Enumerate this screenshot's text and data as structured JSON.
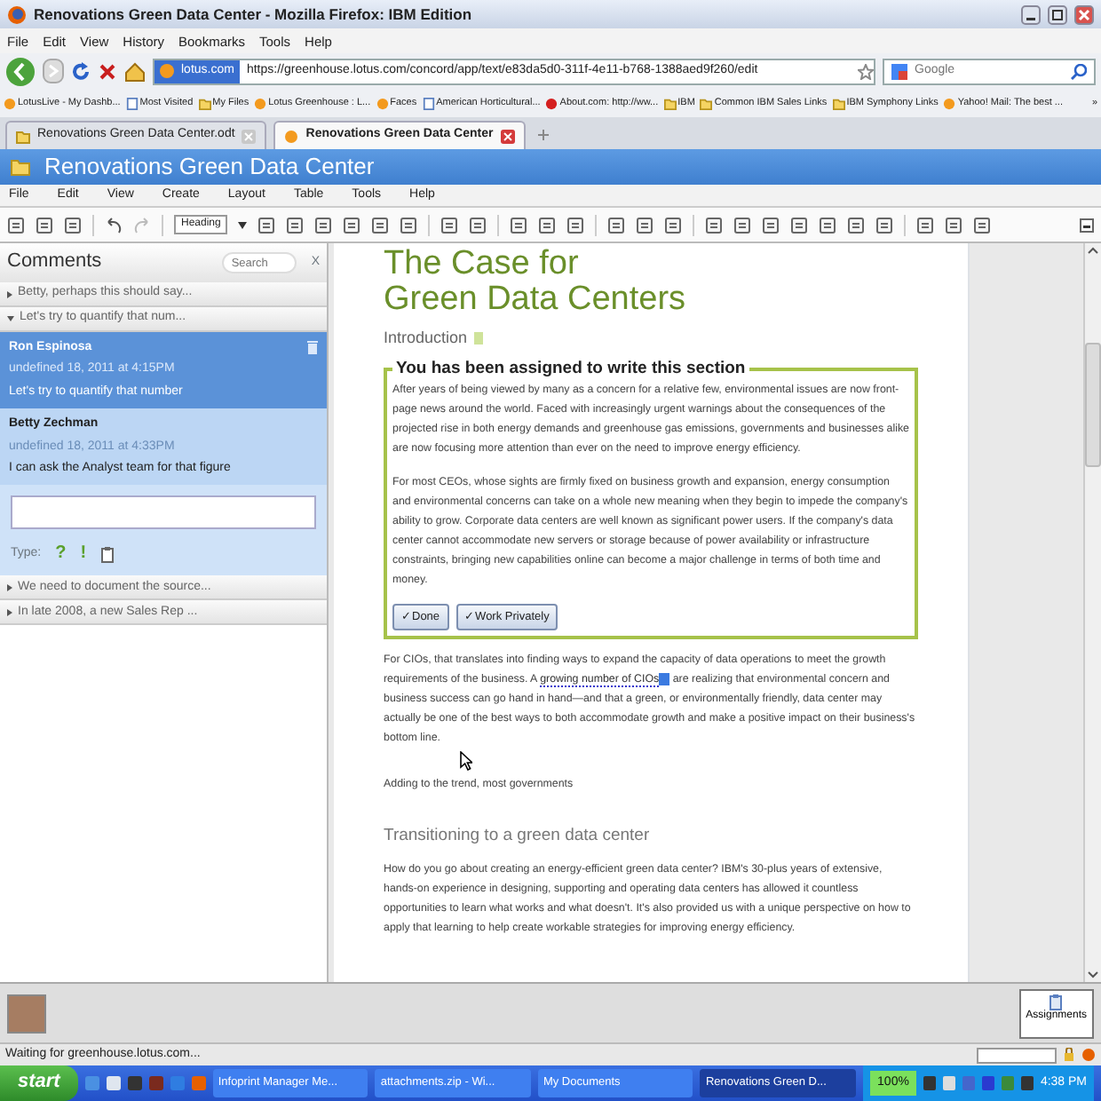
{
  "window": {
    "title": "Renovations Green Data Center - Mozilla Firefox: IBM Edition"
  },
  "menu_bar": [
    "File",
    "Edit",
    "View",
    "History",
    "Bookmarks",
    "Tools",
    "Help"
  ],
  "address_bar": {
    "site_label": "lotus.com",
    "url": "https://greenhouse.lotus.com/concord/app/text/e83da5d0-311f-4e11-b768-1388aed9f260/edit"
  },
  "search_field": {
    "placeholder": "Google"
  },
  "bookmarks": [
    {
      "label": "LotusLive - My Dashb...",
      "kind": "site"
    },
    {
      "label": "Most Visited",
      "kind": "page"
    },
    {
      "label": "My Files",
      "kind": "folder"
    },
    {
      "label": "Lotus Greenhouse : L...",
      "kind": "site"
    },
    {
      "label": "Faces",
      "kind": "site"
    },
    {
      "label": "American Horticultural...",
      "kind": "page"
    },
    {
      "label": "About.com: http://ww...",
      "kind": "ball"
    },
    {
      "label": "IBM",
      "kind": "folder"
    },
    {
      "label": "Common IBM Sales Links",
      "kind": "folder"
    },
    {
      "label": "IBM Symphony Links",
      "kind": "folder"
    },
    {
      "label": "Yahoo! Mail: The best ...",
      "kind": "site"
    }
  ],
  "bookmarks_more": "»",
  "tabs": [
    {
      "label": "Renovations Green Data Center.odt",
      "selected": false
    },
    {
      "label": "Renovations Green Data Center",
      "selected": true
    }
  ],
  "app": {
    "title": "Renovations Green Data Center",
    "menu": [
      "File",
      "Edit",
      "View",
      "Create",
      "Layout",
      "Table",
      "Tools",
      "Help"
    ],
    "style_select": "Heading"
  },
  "comments": {
    "title": "Comments",
    "search_placeholder": "Search",
    "close": "X",
    "threads": [
      {
        "summary": "Betty, perhaps this should say...",
        "expanded": false
      },
      {
        "summary": "Let's try to quantify that num...",
        "expanded": true,
        "replies": [
          {
            "author": "Ron Espinosa",
            "time": "undefined 18, 2011 at 4:15PM",
            "text": "Let's try to quantify that number",
            "selected": true
          },
          {
            "author": "Betty Zechman",
            "time": "undefined 18, 2011 at 4:33PM",
            "text": "I can ask the Analyst team for that figure",
            "selected": false
          }
        ],
        "type_label": "Type:",
        "type_options": [
          "?",
          "!"
        ]
      },
      {
        "summary": "We need to document the source...",
        "expanded": false
      },
      {
        "summary": "In late 2008, a new Sales Rep ...",
        "expanded": false
      }
    ]
  },
  "document": {
    "title_lines": [
      "The Case for",
      "Green Data Centers"
    ],
    "intro_heading": "Introduction",
    "assignment": {
      "legend": "You has been assigned to write this section",
      "paragraphs": [
        "After years of being viewed by many as a concern for a relative few, environmental issues are now front-page news around the world. Faced with increasingly urgent warnings about the consequences of the projected rise in both energy demands and greenhouse gas emissions, governments and businesses alike are now focusing more attention than ever on the need to improve energy efficiency.",
        "For most CEOs, whose sights are firmly fixed on business growth and expansion, energy consumption and environmental concerns can take on a whole new meaning when they begin to impede the company's ability to grow. Corporate data centers are well known as significant power users. If the company's data center cannot accommodate new servers or storage because of power availability or infrastructure constraints, bringing new capabilities online can become a major challenge in terms of both time and money."
      ],
      "buttons": [
        "✓Done",
        "✓Work Privately"
      ]
    },
    "cio_paragraph": {
      "before": "For CIOs, that translates into finding ways to expand the capacity of data operations to meet the growth requirements of the business. A",
      "link": "growing number of CIOs",
      "after": "are realizing that environmental concern and business success can go hand in hand—and that a green, or environmentally friendly, data center may actually be one of the best ways to both accommodate growth and make a positive impact on their business's bottom line."
    },
    "trend_paragraph": "Adding to the trend, most governments",
    "section_heading": "Transitioning to a green data center",
    "section_paragraph": "How do you go about creating an energy-efficient green data center? IBM's 30-plus years of extensive, hands-on experience in designing, supporting and operating data centers has allowed it countless opportunities to learn what works and what doesn't. It's also provided us with a unique perspective on how to apply that learning to help create workable strategies for improving energy efficiency."
  },
  "bottom_panel": {
    "assignments_button": "Assignments"
  },
  "status_bar": "Waiting for greenhouse.lotus.com...",
  "taskbar": {
    "start": "start",
    "tasks": [
      {
        "label": "Infoprint Manager Me...",
        "selected": false
      },
      {
        "label": "attachments.zip - Wi...",
        "selected": false
      },
      {
        "label": "My Documents",
        "selected": false
      },
      {
        "label": "Renovations Green D...",
        "selected": true
      }
    ],
    "zoom": "100%",
    "clock": "4:38 PM"
  }
}
